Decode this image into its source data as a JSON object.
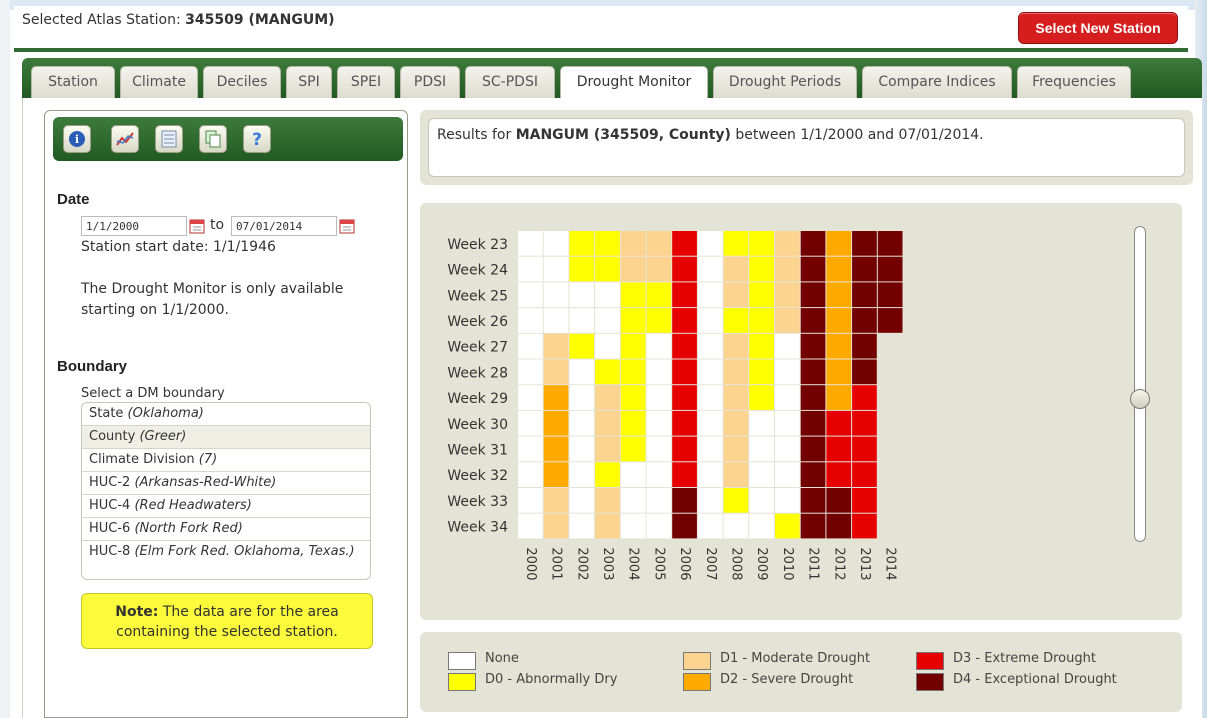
{
  "header": {
    "label": "Selected Atlas Station:",
    "station": "345509 (MANGUM)",
    "button": "Select New Station"
  },
  "tabs": [
    "Station",
    "Climate",
    "Deciles",
    "SPI",
    "SPEI",
    "PDSI",
    "SC-PDSI",
    "Drought Monitor",
    "Drought Periods",
    "Compare Indices",
    "Frequencies"
  ],
  "active_tab": "Drought Monitor",
  "toolbar": [
    "info-icon",
    "chart-icon",
    "table-icon",
    "copy-icon",
    "help-icon"
  ],
  "sidebar": {
    "date_title": "Date",
    "start_date": "1/1/2000",
    "to_label": "to",
    "end_date": "07/01/2014",
    "station_start": "Station start date: 1/1/1946",
    "availability_line1": "The Drought Monitor is only available",
    "availability_line2": "starting on 1/1/2000.",
    "boundary_title": "Boundary",
    "boundary_prompt": "Select a DM boundary",
    "boundaries": [
      {
        "label": "State ",
        "detail": "(Oklahoma)"
      },
      {
        "label": "County ",
        "detail": "(Greer)"
      },
      {
        "label": "Climate Division ",
        "detail": "(7)"
      },
      {
        "label": "HUC-2 ",
        "detail": "(Arkansas-Red-White)"
      },
      {
        "label": "HUC-4 ",
        "detail": "(Red Headwaters)"
      },
      {
        "label": "HUC-6 ",
        "detail": "(North Fork Red)"
      },
      {
        "label": "HUC-8 ",
        "detail": "(Elm Fork Red. Oklahoma, Texas.)"
      }
    ],
    "selected_boundary": "County ",
    "note_bold": "Note:",
    "note_text": " The data are for the area containing the selected station."
  },
  "results": {
    "prefix": "Results for ",
    "bold": "MANGUM (345509, County)",
    "suffix": " between 1/1/2000 and 07/01/2014."
  },
  "legend": [
    {
      "label": "None",
      "color": "#ffffff"
    },
    {
      "label": "D0 - Abnormally Dry",
      "color": "#ffff00"
    },
    {
      "label": "D1 - Moderate Drought",
      "color": "#fcd38f"
    },
    {
      "label": "D2 - Severe Drought",
      "color": "#ffaa00"
    },
    {
      "label": "D3 - Extreme Drought",
      "color": "#e60000"
    },
    {
      "label": "D4 - Exceptional Drought",
      "color": "#730000"
    }
  ],
  "chart_data": {
    "type": "heatmap",
    "x": [
      "2000",
      "2001",
      "2002",
      "2003",
      "2004",
      "2005",
      "2006",
      "2007",
      "2008",
      "2009",
      "2010",
      "2011",
      "2012",
      "2013",
      "2014"
    ],
    "y": [
      "Week 23",
      "Week 24",
      "Week 25",
      "Week 26",
      "Week 27",
      "Week 28",
      "Week 29",
      "Week 30",
      "Week 31",
      "Week 32",
      "Week 33",
      "Week 34"
    ],
    "levels": [
      "None",
      "D0",
      "D1",
      "D2",
      "D3",
      "D4"
    ],
    "values": [
      [
        -1,
        -1,
        0,
        0,
        1,
        1,
        3,
        -1,
        0,
        0,
        1,
        4,
        2,
        4,
        4
      ],
      [
        -1,
        -1,
        0,
        0,
        1,
        1,
        3,
        -1,
        1,
        0,
        1,
        4,
        2,
        4,
        4
      ],
      [
        -1,
        -1,
        -1,
        -1,
        0,
        0,
        3,
        -1,
        1,
        0,
        1,
        4,
        2,
        4,
        4
      ],
      [
        -1,
        -1,
        -1,
        -1,
        0,
        0,
        3,
        -1,
        0,
        0,
        1,
        4,
        2,
        4,
        4
      ],
      [
        -1,
        1,
        0,
        -1,
        0,
        -1,
        3,
        -1,
        1,
        0,
        -1,
        4,
        2,
        4,
        null
      ],
      [
        -1,
        1,
        -1,
        0,
        0,
        -1,
        3,
        -1,
        1,
        0,
        -1,
        4,
        2,
        4,
        null
      ],
      [
        -1,
        2,
        -1,
        1,
        0,
        -1,
        3,
        -1,
        1,
        0,
        -1,
        4,
        2,
        3,
        null
      ],
      [
        -1,
        2,
        -1,
        1,
        0,
        -1,
        3,
        -1,
        1,
        -1,
        -1,
        4,
        3,
        3,
        null
      ],
      [
        -1,
        2,
        -1,
        1,
        0,
        -1,
        3,
        -1,
        1,
        -1,
        -1,
        4,
        3,
        3,
        null
      ],
      [
        -1,
        2,
        -1,
        0,
        -1,
        -1,
        3,
        -1,
        1,
        -1,
        -1,
        4,
        3,
        3,
        null
      ],
      [
        -1,
        1,
        -1,
        1,
        -1,
        -1,
        4,
        -1,
        0,
        -1,
        -1,
        4,
        4,
        3,
        null
      ],
      [
        -1,
        1,
        -1,
        1,
        -1,
        -1,
        4,
        -1,
        -1,
        -1,
        0,
        4,
        4,
        3,
        null
      ]
    ],
    "colors": {
      "-1": "#ffffff",
      "0": "#ffff00",
      "1": "#fcd38f",
      "2": "#ffaa00",
      "3": "#e60000",
      "4": "#730000"
    }
  }
}
